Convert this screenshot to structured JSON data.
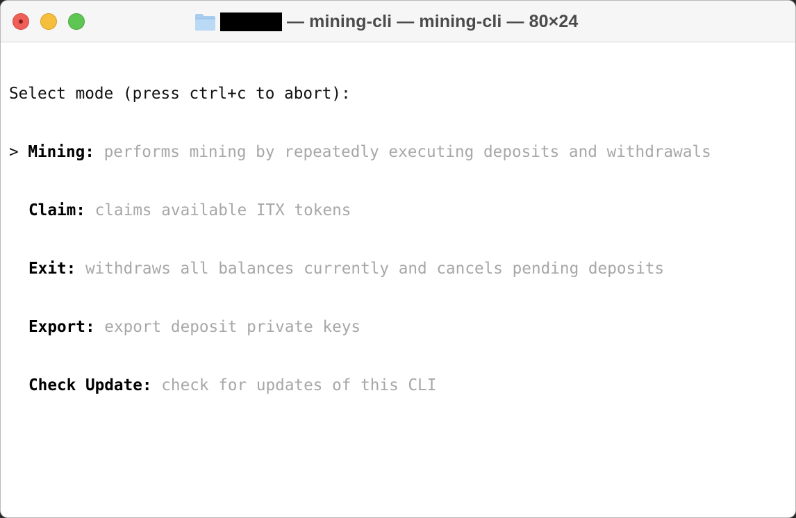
{
  "window": {
    "title": "— mining-cli — mining-cli — 80×24",
    "redacted_folder_name": ""
  },
  "terminal": {
    "prompt": "Select mode (press ctrl+c to abort):",
    "cursor": ">",
    "options": [
      {
        "label": "Mining:",
        "description": "performs mining by repeatedly executing deposits and withdrawals",
        "selected": true
      },
      {
        "label": "Claim:",
        "description": "claims available ITX tokens",
        "selected": false
      },
      {
        "label": "Exit:",
        "description": "withdraws all balances currently and cancels pending deposits",
        "selected": false
      },
      {
        "label": "Export:",
        "description": "export deposit private keys",
        "selected": false
      },
      {
        "label": "Check Update:",
        "description": "check for updates of this CLI",
        "selected": false
      }
    ]
  },
  "colors": {
    "close": "#ee5f57",
    "minimize": "#f5be3c",
    "zoom": "#5fc553",
    "description_text": "#a7a7a7",
    "folder_icon": "#a9cdee"
  },
  "icons": {
    "folder": "folder-icon",
    "close": "close-icon"
  }
}
